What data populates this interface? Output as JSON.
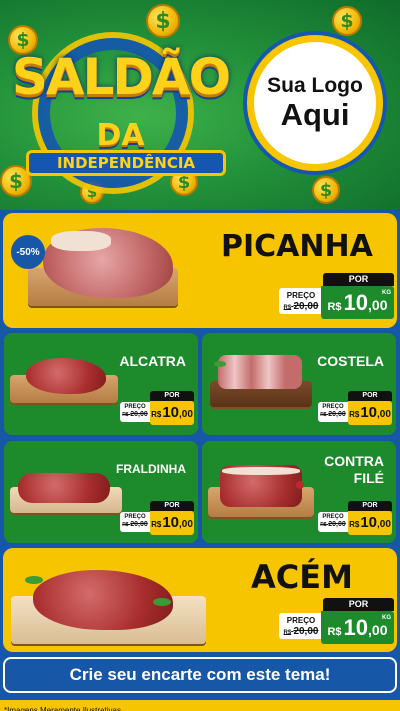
{
  "header": {
    "title_main": "SALDÃO",
    "title_da": "DA",
    "title_sub": "INDEPENDÊNCIA",
    "logo_line1": "Sua Logo",
    "logo_line2": "Aqui",
    "coin_symbol": "$"
  },
  "products": {
    "picanha": {
      "name": "PICANHA",
      "discount": "-50%",
      "por": "POR",
      "preco": "PREÇO",
      "old_prefix": "R$",
      "old_price": "20,00",
      "currency": "R$",
      "int": "10",
      "dec": ",00",
      "unit": "KG"
    },
    "alcatra": {
      "name": "ALCATRA",
      "por": "POR",
      "preco": "PREÇO",
      "old_prefix": "R$",
      "old_price": "20,00",
      "currency": "R$",
      "int": "10",
      "dec": ",00"
    },
    "costela": {
      "name": "COSTELA",
      "por": "POR",
      "preco": "PREÇO",
      "old_prefix": "R$",
      "old_price": "20,00",
      "currency": "R$",
      "int": "10",
      "dec": ",00"
    },
    "fraldinha": {
      "name": "FRALDINHA",
      "por": "POR",
      "preco": "PREÇO",
      "old_prefix": "R$",
      "old_price": "20,00",
      "currency": "R$",
      "int": "10",
      "dec": ",00"
    },
    "contrafile": {
      "name_l1": "CONTRA",
      "name_l2": "FILÉ",
      "por": "POR",
      "preco": "PREÇO",
      "old_prefix": "R$",
      "old_price": "20,00",
      "currency": "R$",
      "int": "10",
      "dec": ",00"
    },
    "acem": {
      "name": "ACÉM",
      "por": "POR",
      "preco": "PREÇO",
      "old_prefix": "R$",
      "old_price": "20,00",
      "currency": "R$",
      "int": "10",
      "dec": ",00",
      "unit": "KG"
    }
  },
  "banner": "Crie seu encarte com este tema!",
  "footnote": "*Imagens Meramente Ilustrativas",
  "colors": {
    "yellow": "#f6c500",
    "green": "#1d8a2c",
    "blue": "#1657a8"
  }
}
